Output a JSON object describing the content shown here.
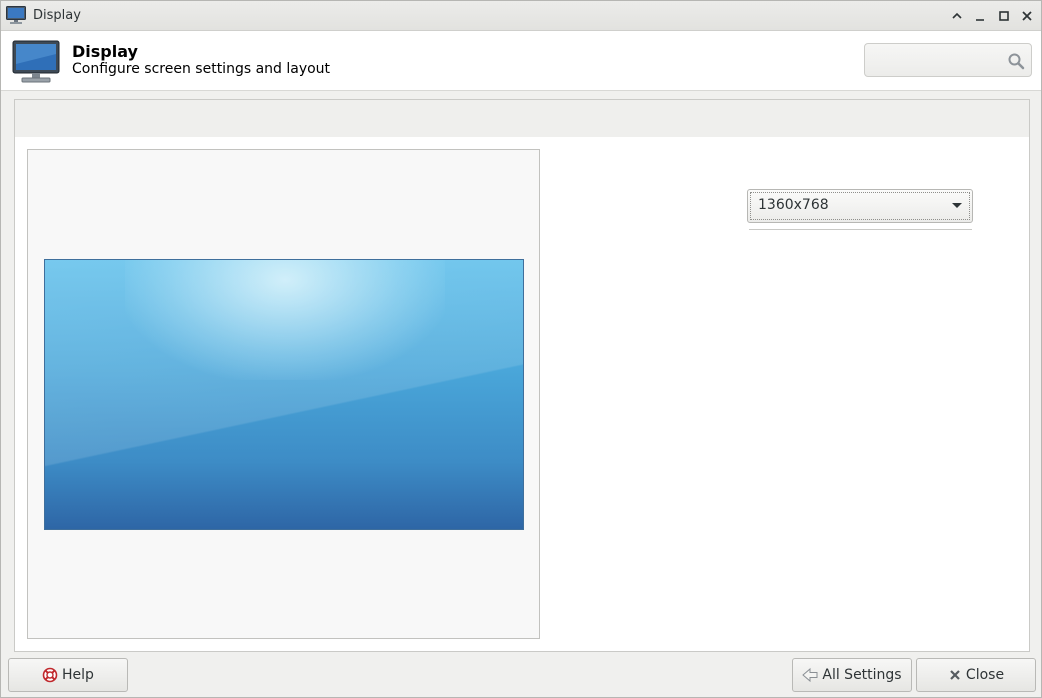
{
  "window": {
    "title": "Display",
    "controls": [
      "shade",
      "minimize",
      "maximize",
      "close"
    ]
  },
  "header": {
    "title": "Display",
    "subtitle": "Configure screen settings and layout",
    "search": {
      "value": "",
      "placeholder": ""
    }
  },
  "display": {
    "resolution": "1360x768"
  },
  "footer": {
    "help_label": "Help",
    "all_settings_label": "All Settings",
    "close_label": "Close"
  },
  "icons": {
    "app": "monitor-icon",
    "search": "search-icon",
    "help": "lifebuoy-icon",
    "all_settings": "back-arrow-icon",
    "close": "close-icon"
  },
  "colors": {
    "wallpaper_top": "#59bdea",
    "wallpaper_bottom": "#2e66a6"
  }
}
